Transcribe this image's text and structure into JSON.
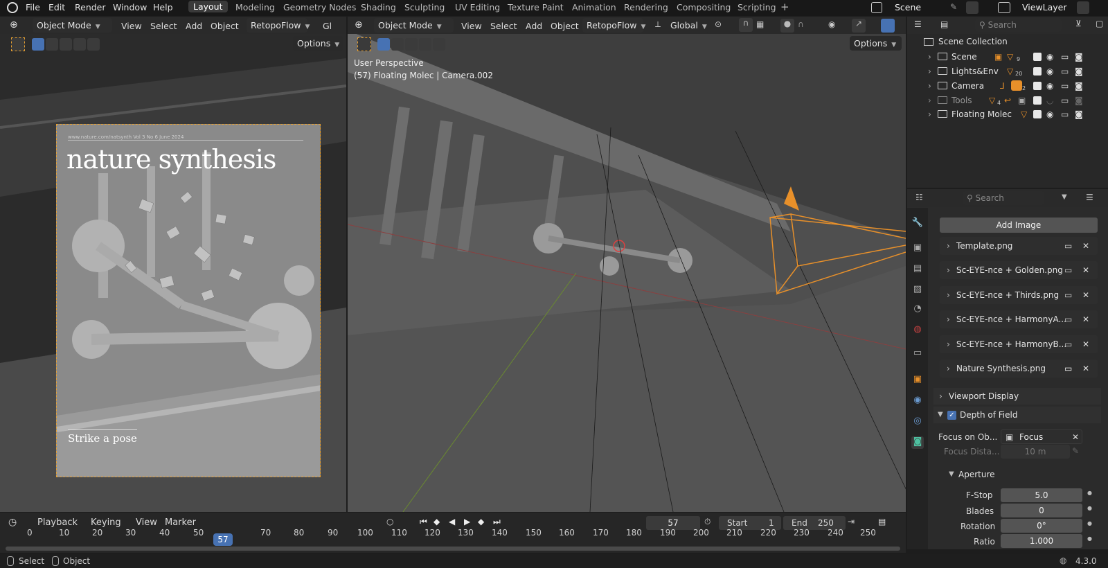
{
  "topbar": {
    "menus": [
      "File",
      "Edit",
      "Render",
      "Window",
      "Help"
    ],
    "workspaces": [
      "Layout",
      "Modeling",
      "Geometry Nodes",
      "Shading",
      "Sculpting",
      "UV Editing",
      "Texture Paint",
      "Animation",
      "Rendering",
      "Compositing",
      "Scripting"
    ],
    "active_workspace": "Layout",
    "add_tab": "+",
    "scene_name": "Scene",
    "viewlayer_name": "ViewLayer"
  },
  "left_viewport": {
    "mode": "Object Mode",
    "menus": [
      "View",
      "Select",
      "Add",
      "Object"
    ],
    "addon": "RetopoFlow",
    "transform_partial": "Gl",
    "options": "Options",
    "cover": {
      "header_line": "www.nature.com/natsynth  Vol 3  No 6  June 2024",
      "title": "nature synthesis",
      "caption": "Strike a pose"
    }
  },
  "right_viewport": {
    "mode": "Object Mode",
    "menus": [
      "View",
      "Select",
      "Add",
      "Object"
    ],
    "addon": "RetopoFlow",
    "transform": "Global",
    "options": "Options",
    "overlay_line1": "User Perspective",
    "overlay_line2": "(57) Floating Molec | Camera.002"
  },
  "outliner": {
    "search_placeholder": "Search",
    "root": "Scene Collection",
    "rows": [
      {
        "label": "Scene",
        "count": "9"
      },
      {
        "label": "Lights&Env",
        "count": "20"
      },
      {
        "label": "Camera",
        "count": "2"
      },
      {
        "label": "Tools",
        "count": "4"
      },
      {
        "label": "Floating Molec",
        "count": ""
      }
    ]
  },
  "properties": {
    "search_placeholder": "Search",
    "add_image": "Add Image",
    "images": [
      "Template.png",
      "Sc-EYE-nce + Golden.png",
      "Sc-EYE-nce + Thirds.png",
      "Sc-EYE-nce + HarmonyA...",
      "Sc-EYE-nce + HarmonyB...",
      "Nature Synthesis.png"
    ],
    "viewport_display": "Viewport Display",
    "dof": "Depth of Field",
    "focus_object_label": "Focus on Ob...",
    "focus_object_value": "Focus",
    "focus_distance_label": "Focus Dista...",
    "focus_distance_value": "10 m",
    "aperture": "Aperture",
    "fstop_label": "F-Stop",
    "fstop_value": "5.0",
    "blades_label": "Blades",
    "blades_value": "0",
    "rotation_label": "Rotation",
    "rotation_value": "0°",
    "ratio_label": "Ratio",
    "ratio_value": "1.000"
  },
  "timeline": {
    "menus": [
      "Playback",
      "Keying",
      "View",
      "Marker"
    ],
    "current_frame": "57",
    "start_label": "Start",
    "start_value": "1",
    "end_label": "End",
    "end_value": "250",
    "ticks": [
      "0",
      "10",
      "20",
      "30",
      "40",
      "50",
      "70",
      "80",
      "90",
      "100",
      "110",
      "120",
      "130",
      "140",
      "150",
      "160",
      "170",
      "180",
      "190",
      "200",
      "210",
      "220",
      "230",
      "240",
      "250"
    ],
    "playhead_label": "57"
  },
  "statusbar": {
    "select": "Select",
    "object": "Object",
    "version": "4.3.0"
  },
  "colors": {
    "accent": "#4772b3",
    "camera": "#e8902a",
    "bg": "#1d1d1d"
  }
}
